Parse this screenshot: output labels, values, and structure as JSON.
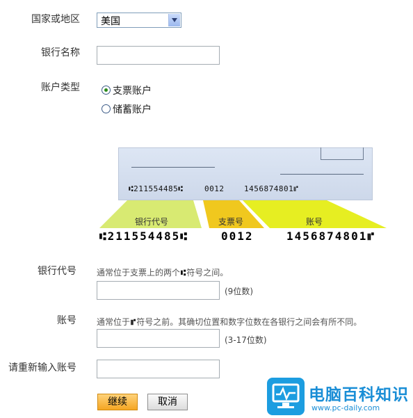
{
  "form": {
    "country_label": "国家或地区",
    "country_value": "美国",
    "bank_name_label": "银行名称",
    "account_type_label": "账户类型",
    "account_types": [
      "支票账户",
      "储蓄账户"
    ],
    "routing_label": "银行代号",
    "routing_hint_before": "通常位于支票上的两个",
    "routing_hint_mark": "⑆",
    "routing_hint_after": "符号之间。",
    "routing_range": "(9位数)",
    "account_label": "账号",
    "account_hint_before": "通常位于",
    "account_hint_mark": "⑈",
    "account_hint_after": "符号之前。其确切位置和数字位数在各银行之间会有所不同。",
    "account_range": "(3-17位数)",
    "reenter_label": "请重新输入账号",
    "continue_label": "继续",
    "cancel_label": "取消"
  },
  "check_diagram": {
    "micr_routing": "⑆211554485⑆",
    "micr_check": "0012",
    "micr_account": "1456874801⑈",
    "band_routing": "银行代号",
    "band_check": "支票号",
    "band_account": "账号",
    "colors": {
      "routing": "#d8ea72",
      "check": "#f0c81e",
      "account": "#e6ee22"
    }
  },
  "watermark": {
    "title": "电脑百科知识",
    "url": "www.pc-daily.com"
  }
}
